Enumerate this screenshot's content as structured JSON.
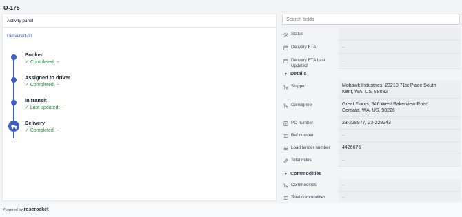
{
  "page_title": "O-175",
  "activity": {
    "header": "Activity panel",
    "delivered_on": "Delivered on",
    "steps": [
      {
        "name": "Booked",
        "status": "Completed: --"
      },
      {
        "name": "Assigned to driver",
        "status": "Completed: --"
      },
      {
        "name": "In transit",
        "status": "Last updated: --"
      },
      {
        "name": "Delivery",
        "status": "Completed: --"
      }
    ]
  },
  "search": {
    "placeholder": "Search fields"
  },
  "fields": {
    "status": {
      "label": "Status",
      "value": ""
    },
    "delivery_eta": {
      "label": "Delivery ETA",
      "value": "--"
    },
    "delivery_eta_last_updated": {
      "label": "Delivery ETA Last Updated",
      "value": "--"
    },
    "details_header": "Details",
    "shipper": {
      "label": "Shipper",
      "value_line1": "Mohawk Industries, 23210 71st Place South",
      "value_line2": "Kent, WA, US, 98032"
    },
    "consignee": {
      "label": "Consignee",
      "value_line1": "Great Floors, 346 West Bakerview Road",
      "value_line2": "Cordata, WA, US, 98226"
    },
    "po_number": {
      "label": "PO number",
      "value": "23-228977, 23-229243"
    },
    "ref_number": {
      "label": "Ref number",
      "value": "--"
    },
    "load_tender_number": {
      "label": "Load tender number",
      "value": "4426676"
    },
    "total_miles": {
      "label": "Total miles",
      "value": "--"
    },
    "commodities_header": "Commodities",
    "commodities": {
      "label": "Commodities",
      "value": "--"
    },
    "total_commodities": {
      "label": "Total commodities",
      "value": "--"
    }
  },
  "footer": {
    "powered_by": "Powered by",
    "brand": "roserocket"
  },
  "colors": {
    "accent": "#3f5fc0",
    "success": "#1f8a3b"
  }
}
